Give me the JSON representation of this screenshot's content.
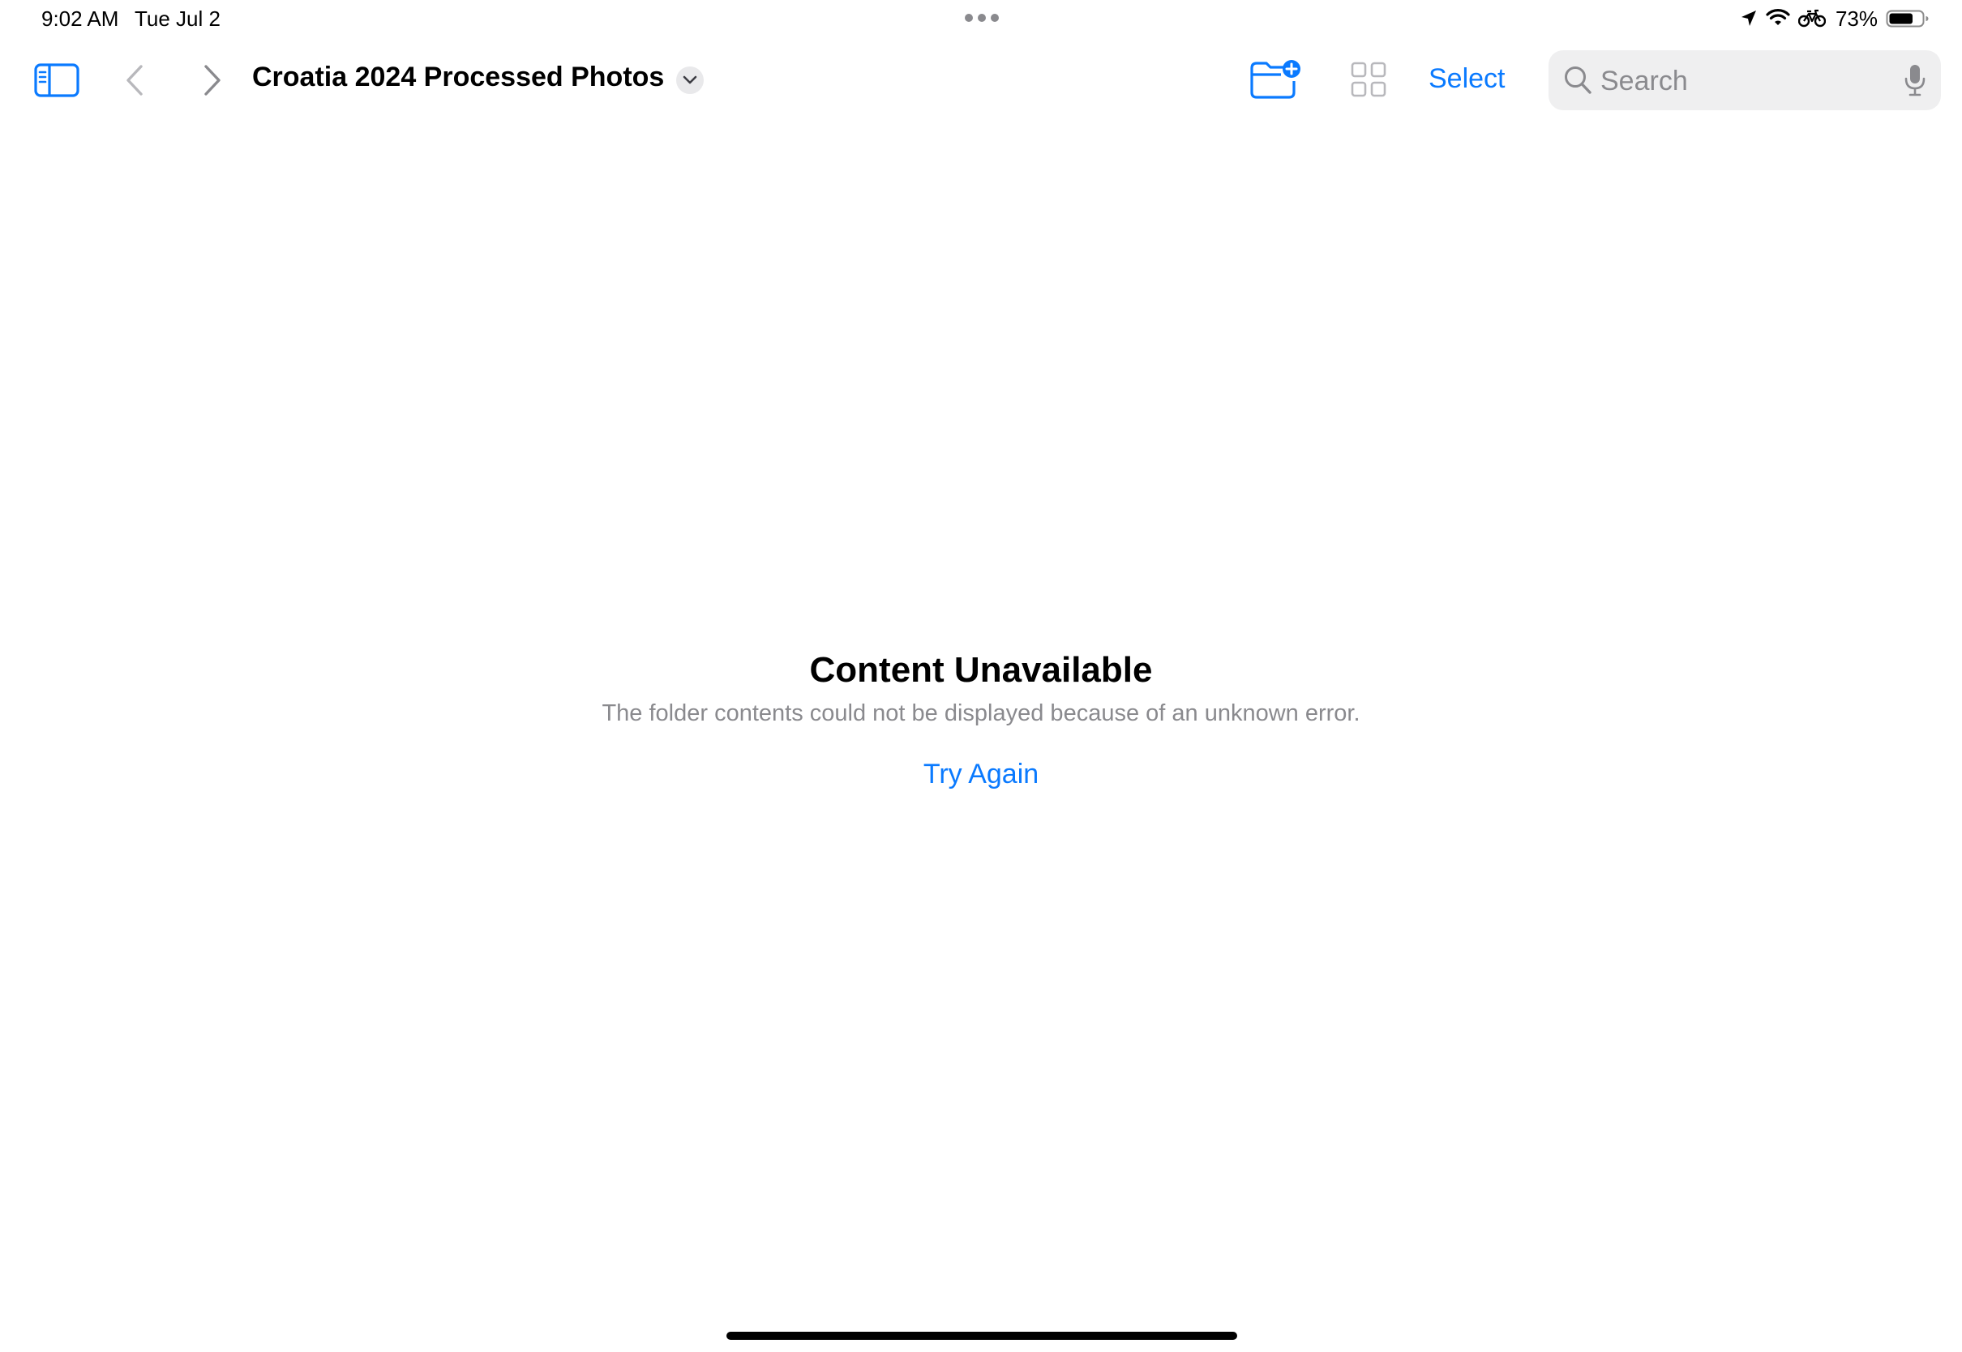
{
  "status_bar": {
    "time": "9:02 AM",
    "date": "Tue Jul 2",
    "battery_percent": "73%",
    "battery_level": 0.73,
    "icons": [
      "location-arrow-icon",
      "wifi-icon",
      "bicycle-icon",
      "battery-icon"
    ]
  },
  "toolbar": {
    "folder_title": "Croatia 2024 Processed Photos",
    "select_label": "Select",
    "accent_color": "#0a7aff"
  },
  "search": {
    "placeholder": "Search",
    "value": ""
  },
  "empty_state": {
    "title": "Content Unavailable",
    "message": "The folder contents could not be displayed because of an unknown error.",
    "action_label": "Try Again"
  }
}
